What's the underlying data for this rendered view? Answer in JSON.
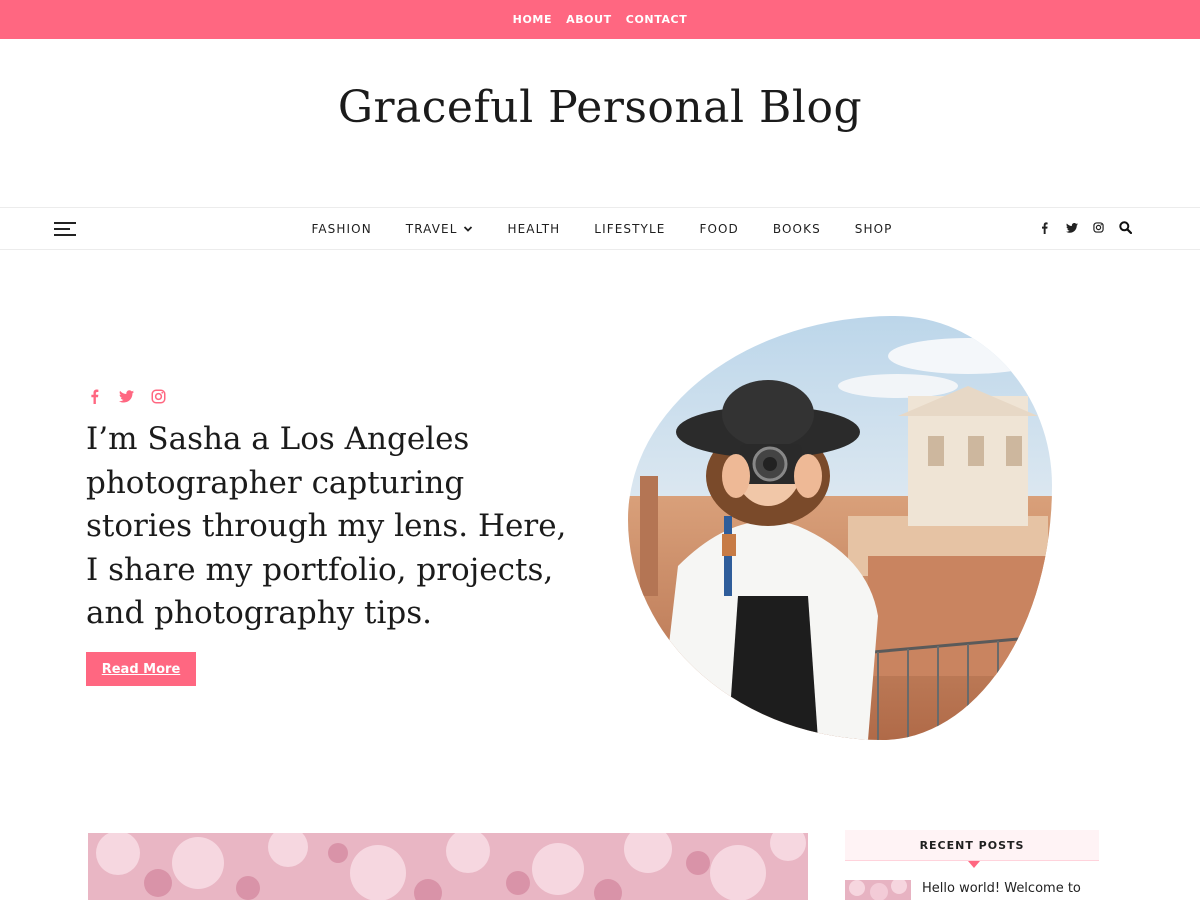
{
  "colors": {
    "accent": "#ff6781",
    "text": "#1b1b1b"
  },
  "top_menu": [
    {
      "label": "HOME"
    },
    {
      "label": "ABOUT"
    },
    {
      "label": "CONTACT"
    }
  ],
  "site_title": "Graceful Personal Blog",
  "main_menu": [
    {
      "label": "FASHION"
    },
    {
      "label": "TRAVEL",
      "has_dropdown": true
    },
    {
      "label": "HEALTH"
    },
    {
      "label": "LIFESTYLE"
    },
    {
      "label": "FOOD"
    },
    {
      "label": "BOOKS"
    },
    {
      "label": "SHOP"
    }
  ],
  "header_icons": [
    "facebook-icon",
    "twitter-icon",
    "instagram-icon",
    "search-icon"
  ],
  "hero": {
    "social_icons": [
      "facebook-icon",
      "twitter-icon",
      "instagram-icon"
    ],
    "text": "I’m Sasha a Los Angeles photographer capturing stories through my lens. Here, I share my portfolio, projects, and photography tips.",
    "button_label": "Read More"
  },
  "sidebar": {
    "widget_title": "RECENT POSTS",
    "recent_posts": [
      {
        "title": "Hello world! Welcome to"
      }
    ]
  }
}
